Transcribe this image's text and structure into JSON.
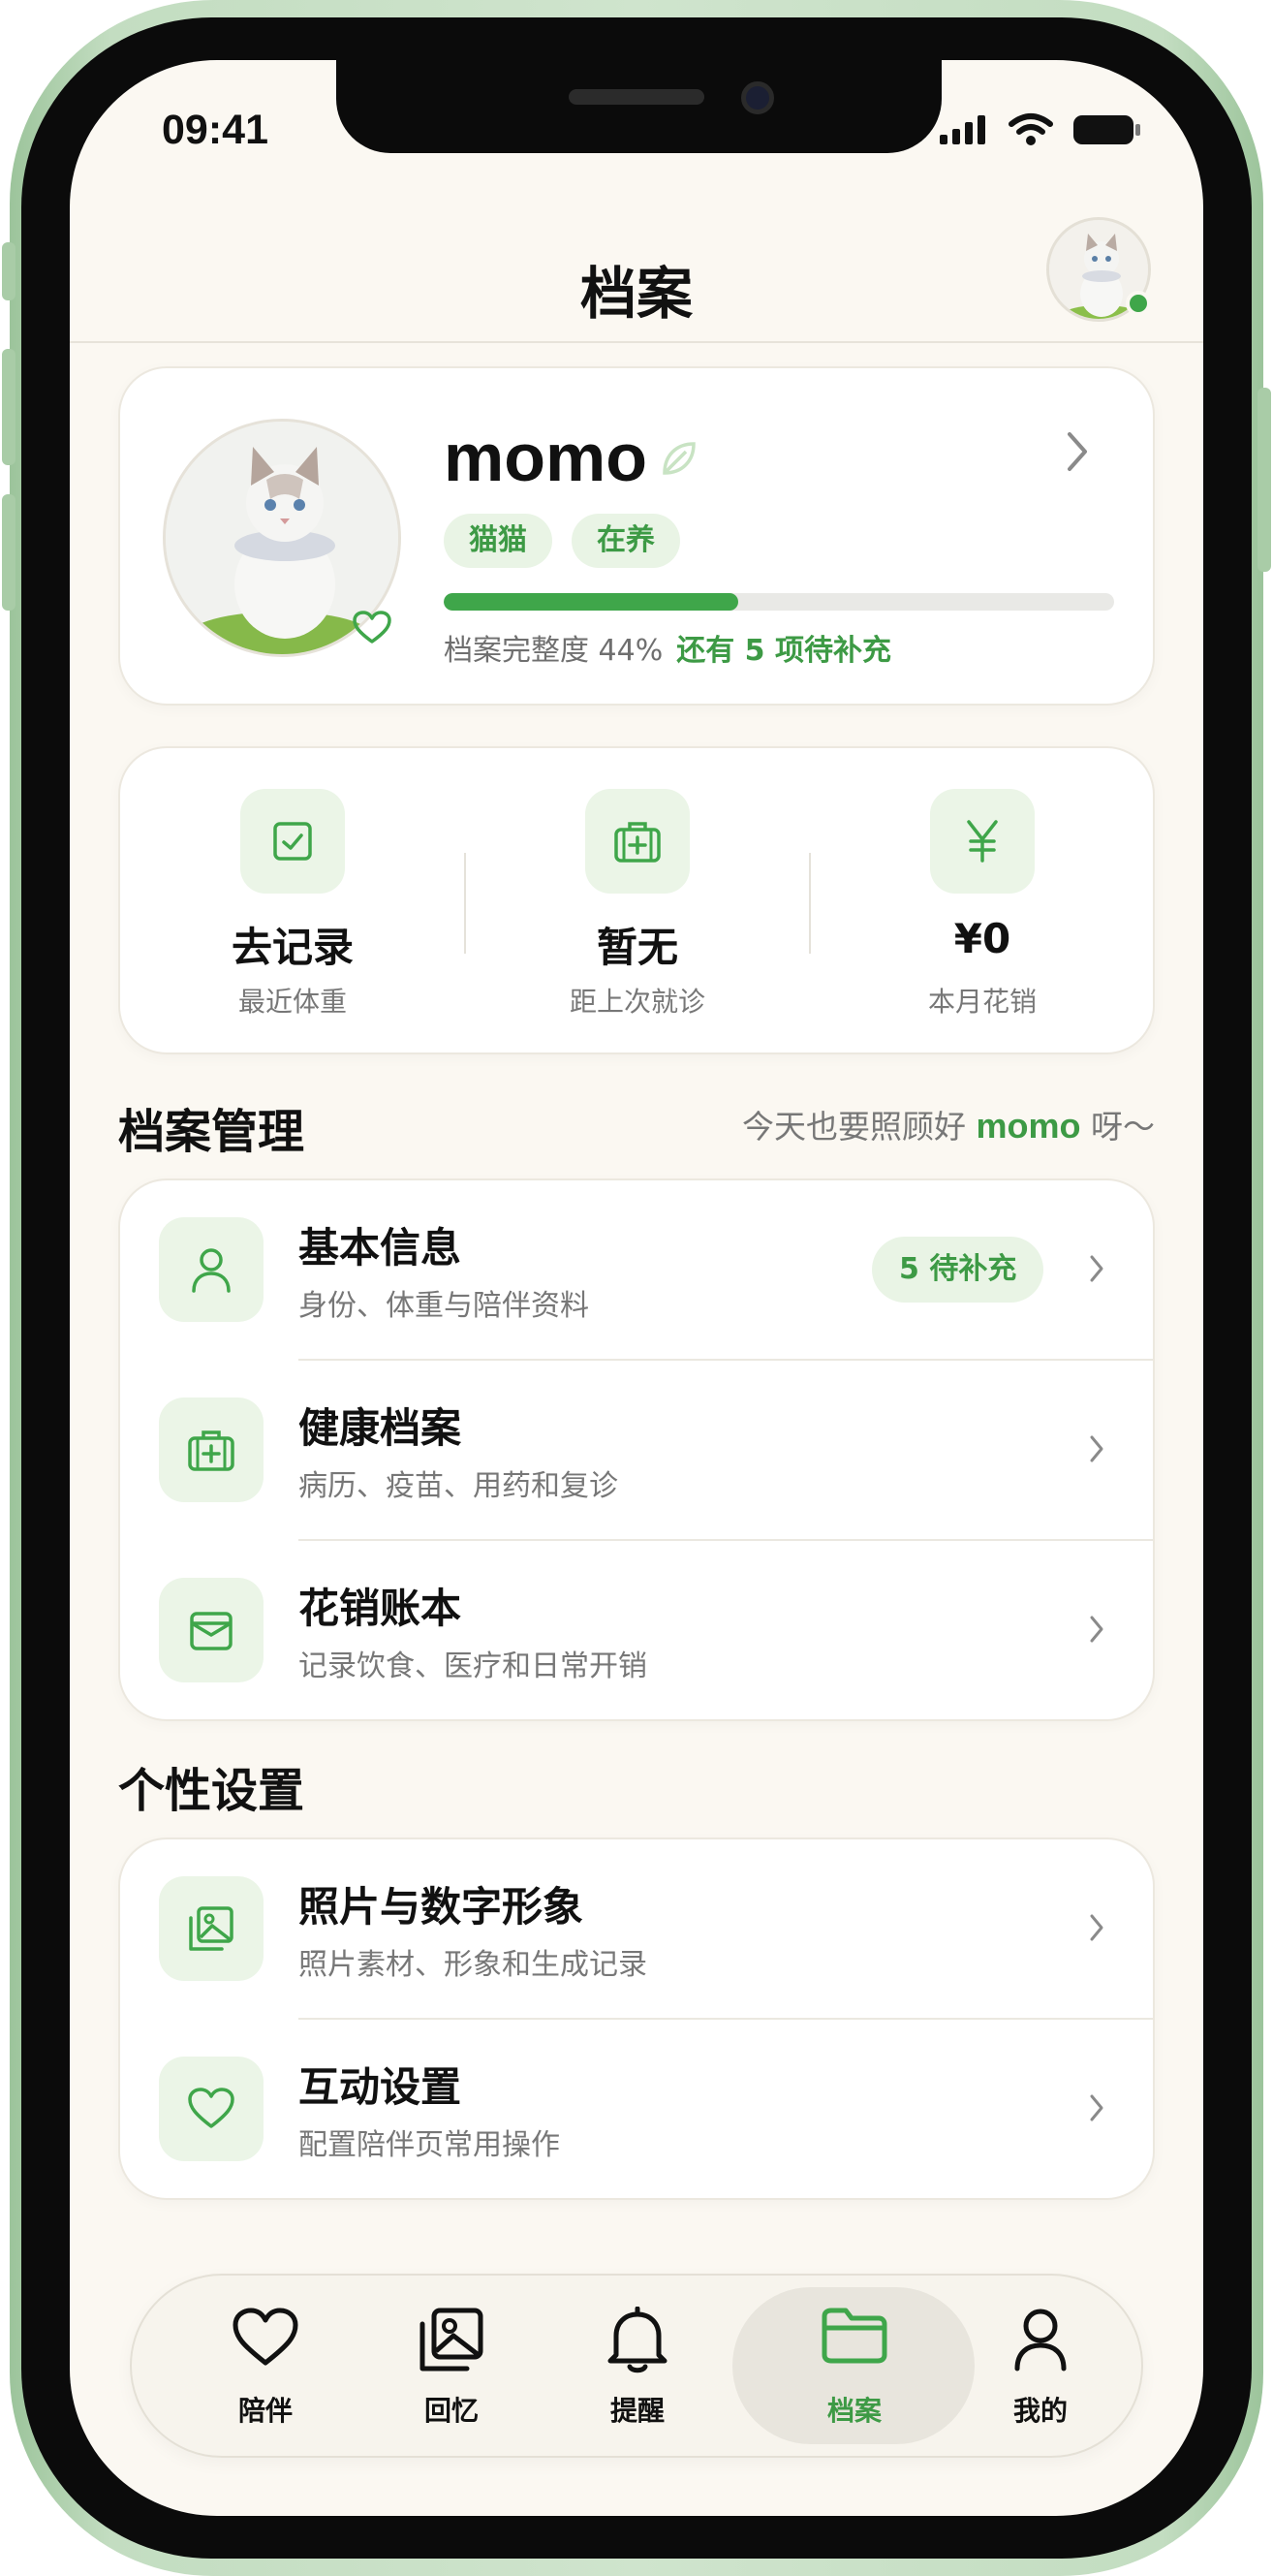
{
  "status_bar": {
    "time": "09:41"
  },
  "header": {
    "title": "档案"
  },
  "profile": {
    "name": "momo",
    "tags": [
      "猫猫",
      "在养"
    ],
    "completion_percent": 44,
    "completion_text": "档案完整度 44%",
    "completion_hint": "还有 5 项待补充"
  },
  "stats": [
    {
      "value": "去记录",
      "label": "最近体重",
      "icon": "check-square-icon"
    },
    {
      "value": "暂无",
      "label": "距上次就诊",
      "icon": "medical-kit-icon"
    },
    {
      "value": "¥0",
      "label": "本月花销",
      "icon": "yen-icon"
    }
  ],
  "archive_section": {
    "title": "档案管理",
    "hint_prefix": "今天也要照顾好",
    "hint_pet": "momo",
    "hint_suffix": "呀～",
    "items": [
      {
        "title": "基本信息",
        "subtitle": "身份、体重与陪伴资料",
        "badge": "5 待补充",
        "icon": "person-icon"
      },
      {
        "title": "健康档案",
        "subtitle": "病历、疫苗、用药和复诊",
        "icon": "medical-kit-icon"
      },
      {
        "title": "花销账本",
        "subtitle": "记录饮食、医疗和日常开销",
        "icon": "wallet-icon"
      }
    ]
  },
  "settings_section": {
    "title": "个性设置",
    "items": [
      {
        "title": "照片与数字形象",
        "subtitle": "照片素材、形象和生成记录",
        "icon": "photo-stack-icon"
      },
      {
        "title": "互动设置",
        "subtitle": "配置陪伴页常用操作",
        "icon": "heart-icon"
      }
    ]
  },
  "tabbar": {
    "active": "档案",
    "tabs": [
      {
        "label": "陪伴",
        "icon": "heart-icon"
      },
      {
        "label": "回忆",
        "icon": "photo-stack-icon"
      },
      {
        "label": "提醒",
        "icon": "bell-icon"
      },
      {
        "label": "档案",
        "icon": "folder-icon"
      },
      {
        "label": "我的",
        "icon": "person-icon"
      }
    ]
  },
  "colors": {
    "accent": "#3fa64a",
    "accent_soft": "#ebf5e7",
    "background": "#fbf8f2"
  }
}
